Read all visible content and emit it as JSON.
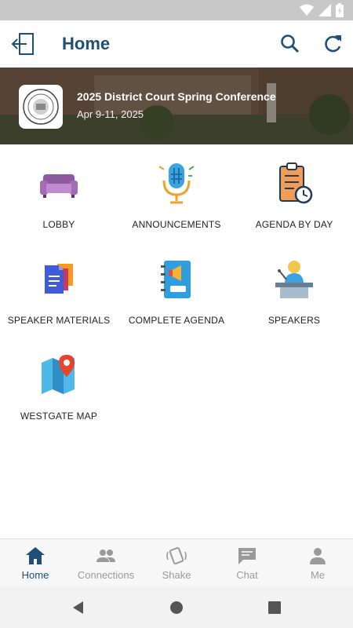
{
  "status_bar": {
    "icons": [
      "wifi-icon",
      "signal-icon",
      "battery-icon"
    ]
  },
  "app_bar": {
    "title": "Home"
  },
  "banner": {
    "conference_title": "2025 District Court Spring Conference",
    "dates": "Apr 9-11, 2025"
  },
  "tiles": [
    {
      "label": "LOBBY",
      "icon": "sofa-icon"
    },
    {
      "label": "ANNOUNCEMENTS",
      "icon": "microphone-icon"
    },
    {
      "label": "AGENDA BY DAY",
      "icon": "clipboard-clock-icon"
    },
    {
      "label": "SPEAKER MATERIALS",
      "icon": "documents-icon"
    },
    {
      "label": "COMPLETE AGENDA",
      "icon": "notebook-megaphone-icon"
    },
    {
      "label": "SPEAKERS",
      "icon": "speaker-podium-icon"
    },
    {
      "label": "WESTGATE MAP",
      "icon": "map-pin-icon"
    }
  ],
  "bottom_nav": {
    "items": [
      {
        "label": "Home",
        "icon": "home-icon",
        "active": true
      },
      {
        "label": "Connections",
        "icon": "people-icon",
        "active": false
      },
      {
        "label": "Shake",
        "icon": "shake-icon",
        "active": false
      },
      {
        "label": "Chat",
        "icon": "chat-icon",
        "active": false
      },
      {
        "label": "Me",
        "icon": "person-icon",
        "active": false
      }
    ]
  },
  "colors": {
    "primary": "#1f4e79",
    "inactive": "#9a9a9a"
  }
}
